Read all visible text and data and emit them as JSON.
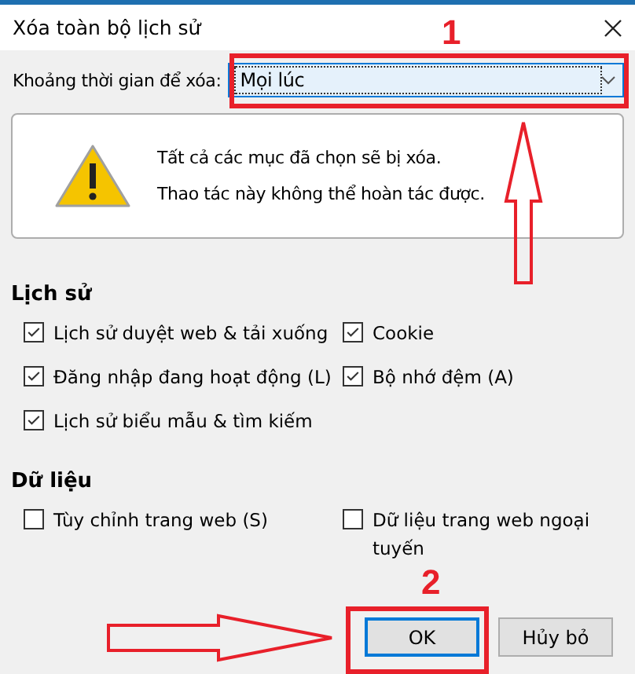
{
  "window": {
    "title": "Xóa toàn bộ lịch sử"
  },
  "time_range": {
    "label": "Khoảng thời gian để xóa:",
    "value": "Mọi lúc"
  },
  "warning": {
    "lines": [
      "Tất cả các mục đã chọn sẽ bị xóa.",
      "Thao tác này không thể hoàn tác được."
    ]
  },
  "sections": [
    {
      "title": "Lịch sử",
      "items": [
        {
          "label": "Lịch sử duyệt web & tải xuống",
          "checked": true
        },
        {
          "label": "Cookie",
          "checked": true
        },
        {
          "label": "Đăng nhập đang hoạt động (L)",
          "checked": true
        },
        {
          "label": "Bộ nhớ đệm (A)",
          "checked": true
        },
        {
          "label": "Lịch sử biểu mẫu & tìm kiếm",
          "checked": true
        }
      ]
    },
    {
      "title": "Dữ liệu",
      "items": [
        {
          "label": "Tùy chỉnh trang web (S)",
          "checked": false
        },
        {
          "label": "Dữ liệu trang web ngoại tuyến",
          "checked": false
        }
      ]
    }
  ],
  "buttons": [
    {
      "label": "OK",
      "selected": true
    },
    {
      "label": "Hủy bỏ",
      "selected": false
    }
  ],
  "annotations": {
    "step_labels": [
      "1",
      "2"
    ]
  }
}
